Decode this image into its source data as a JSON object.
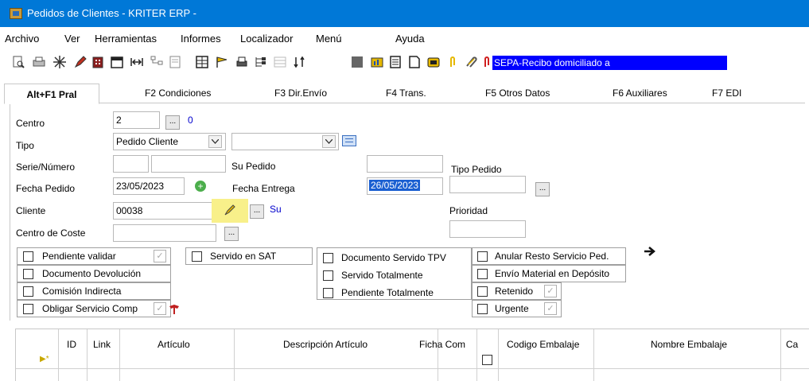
{
  "window": {
    "title": "Pedidos de Clientes - KRITER ERP -"
  },
  "menu": [
    "Archivo",
    "Ver",
    "Herramientas",
    "Informes",
    "Localizador",
    "Menú",
    "Ayuda"
  ],
  "toolbar": {
    "icons": [
      "print-preview-icon",
      "print-icon",
      "sparkle-icon",
      "edit-pencil-icon",
      "building-icon",
      "calendar-icon",
      "navigate-icon",
      "hierarchy-icon",
      "note-icon",
      "grid-icon",
      "flag-icon",
      "printer-stack-icon",
      "tree-icon",
      "table-icon",
      "sort-icon",
      "square-icon",
      "folder-chart-icon",
      "document-icon",
      "blank-page-icon",
      "archive-icon",
      "paperclip-icon",
      "paperclip-alt-icon",
      "paperclip-red-icon"
    ],
    "sepa_text": "SEPA-Recibo domiciliado a"
  },
  "tabs": [
    "Alt+F1 Pral",
    "F2 Condiciones",
    "F3 Dir.Envío",
    "F4 Trans.",
    "F5 Otros Datos",
    "F6 Auxiliares",
    "F7 EDI"
  ],
  "form": {
    "centro": {
      "label": "Centro",
      "value": "2",
      "code": "0"
    },
    "tipo": {
      "label": "Tipo",
      "value": "Pedido Cliente",
      "second_value": ""
    },
    "serie": {
      "label": "Serie/Número",
      "serie": "",
      "numero": ""
    },
    "su_pedido": {
      "label": "Su Pedido",
      "value": ""
    },
    "tipo_pedido": {
      "label": "Tipo Pedido",
      "value": ""
    },
    "fecha_pedido": {
      "label": "Fecha Pedido",
      "value": "23/05/2023"
    },
    "fecha_entrega": {
      "label": "Fecha Entrega",
      "value": "26/05/2023"
    },
    "cliente": {
      "label": "Cliente",
      "value": "00038",
      "suffix": "Su"
    },
    "prioridad": {
      "label": "Prioridad",
      "value": ""
    },
    "centro_coste": {
      "label": "Centro de Coste",
      "value": ""
    }
  },
  "checkboxes": {
    "pendiente_validar": "Pendiente validar",
    "documento_devolucion": "Documento Devolución",
    "comision_indirecta": "Comisión Indirecta",
    "obligar_servicio": "Obligar Servicio Comp",
    "servido_sat": "Servido en SAT",
    "documento_servido_tpv": "Documento Servido TPV",
    "servido_totalmente": "Servido Totalmente",
    "pendiente_totalmente": "Pendiente Totalmente",
    "anular_resto": "Anular Resto Servicio Ped.",
    "envio_material": "Envío Material en Depósito",
    "retenido": "Retenido",
    "urgente": "Urgente"
  },
  "grid": {
    "headers": [
      "ID",
      "Link",
      "Artículo",
      "Descripción Artículo",
      "Ficha Com",
      "Codigo Embalaje",
      "Nombre Embalaje",
      "Ca"
    ]
  },
  "colors": {
    "titlebar": "#0078d7",
    "selection": "#0000ff",
    "highlight": "#f8f08a",
    "link": "#0000cc"
  }
}
